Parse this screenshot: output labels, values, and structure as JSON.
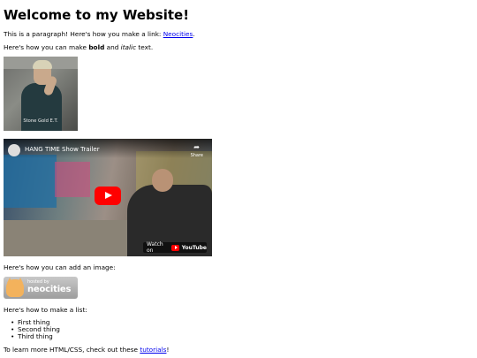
{
  "heading": "Welcome to my Website!",
  "intro": {
    "text_before": "This is a paragraph! Here's how you make a link: ",
    "link_text": "Neocities",
    "text_after": "."
  },
  "formatting": {
    "text_before": "Here's how you can make ",
    "bold_text": "bold",
    "text_middle": " and ",
    "italic_text": "italic",
    "text_after": " text."
  },
  "photo": {
    "caption": "Stone Gold E.T."
  },
  "video": {
    "title": "HANG TIME Show Trailer",
    "share_label": "Share",
    "watch_on_label": "Watch on",
    "brand": "YouTube"
  },
  "image_section": {
    "label": "Here's how you can add an image:"
  },
  "badge": {
    "hosted_by": "hosted by",
    "brand": "neocities"
  },
  "list_section": {
    "label": "Here's how to make a list:",
    "items": [
      "First thing",
      "Second thing",
      "Third thing"
    ]
  },
  "footer": {
    "text_before": "To learn more HTML/CSS, check out these ",
    "link_text": "tutorials",
    "text_after": "!"
  },
  "colors": {
    "link": "#0000ee",
    "youtube_red": "#ff0000"
  }
}
